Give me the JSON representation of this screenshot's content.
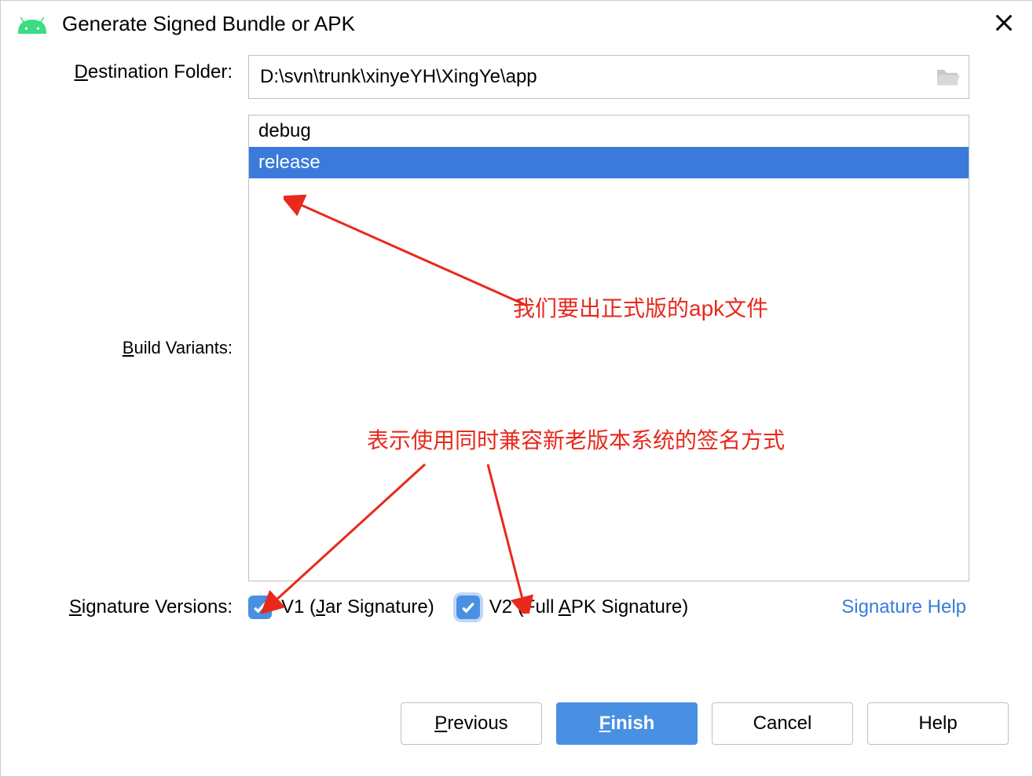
{
  "title": "Generate Signed Bundle or APK",
  "labels": {
    "destination_folder": "Destination Folder:",
    "build_variants": "Build Variants:",
    "signature_versions": "Signature Versions:"
  },
  "destination_folder_value": "D:\\svn\\trunk\\xinyeYH\\XingYe\\app",
  "build_variants": {
    "items": [
      "debug",
      "release"
    ],
    "selected": "release"
  },
  "signature": {
    "v1_checked": true,
    "v1_label": "V1 (Jar Signature)",
    "v2_checked": true,
    "v2_label": "V2 (Full APK Signature)",
    "help_link": "Signature Help"
  },
  "buttons": {
    "previous": "Previous",
    "finish": "Finish",
    "cancel": "Cancel",
    "help": "Help"
  },
  "annotations": {
    "release_note": "我们要出正式版的apk文件",
    "signature_note": "表示使用同时兼容新老版本系统的签名方式"
  }
}
